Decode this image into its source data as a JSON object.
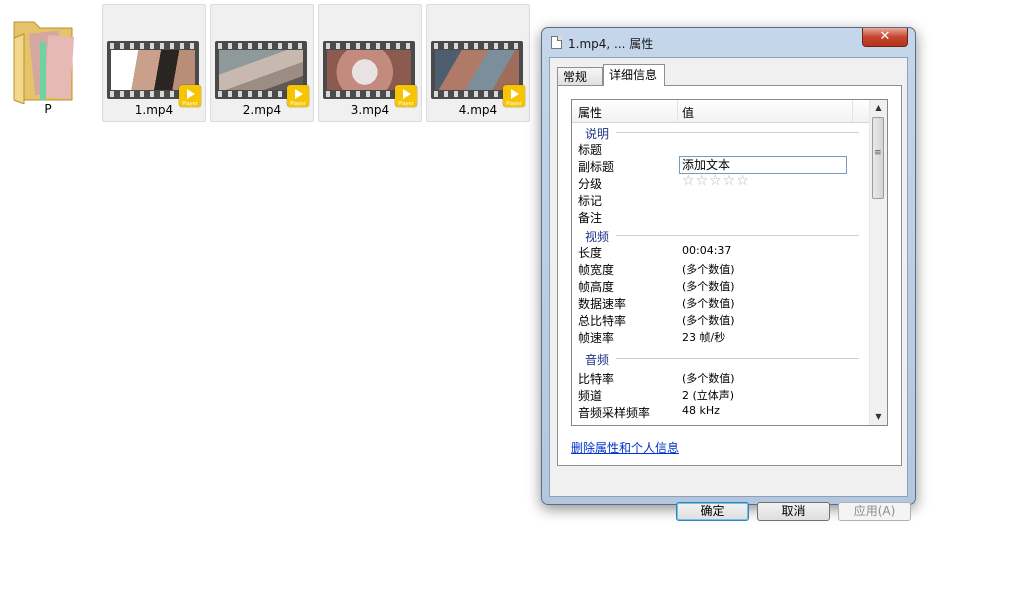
{
  "desktop": {
    "items": [
      {
        "label": "P",
        "type": "folder"
      },
      {
        "label": "1.mp4",
        "type": "video"
      },
      {
        "label": "2.mp4",
        "type": "video"
      },
      {
        "label": "3.mp4",
        "type": "video"
      },
      {
        "label": "4.mp4",
        "type": "video"
      }
    ],
    "badge_text": "Player"
  },
  "dialog": {
    "title": "1.mp4, ... 属性",
    "close_symbol": "✕",
    "tabs": [
      {
        "label": "常规",
        "active": false
      },
      {
        "label": "详细信息",
        "active": true
      }
    ],
    "list": {
      "col_property": "属性",
      "col_value": "值",
      "groups": [
        {
          "name": "说明",
          "props": [
            {
              "key": "标题",
              "value": ""
            },
            {
              "key": "副标题",
              "value": "添加文本"
            },
            {
              "key": "分级",
              "value": "☆☆☆☆☆"
            },
            {
              "key": "标记",
              "value": ""
            },
            {
              "key": "备注",
              "value": ""
            }
          ]
        },
        {
          "name": "视频",
          "props": [
            {
              "key": "长度",
              "value": "00:04:37"
            },
            {
              "key": "帧宽度",
              "value": "(多个数值)"
            },
            {
              "key": "帧高度",
              "value": "(多个数值)"
            },
            {
              "key": "数据速率",
              "value": "(多个数值)"
            },
            {
              "key": "总比特率",
              "value": "(多个数值)"
            },
            {
              "key": "帧速率",
              "value": "23 帧/秒"
            }
          ]
        },
        {
          "name": "音频",
          "props": [
            {
              "key": "比特率",
              "value": "(多个数值)"
            },
            {
              "key": "频道",
              "value": "2 (立体声)"
            },
            {
              "key": "音频采样频率",
              "value": "48 kHz"
            }
          ]
        }
      ]
    },
    "remove_link": "删除属性和个人信息",
    "buttons": {
      "ok": "确定",
      "cancel": "取消",
      "apply": "应用(A)"
    }
  }
}
